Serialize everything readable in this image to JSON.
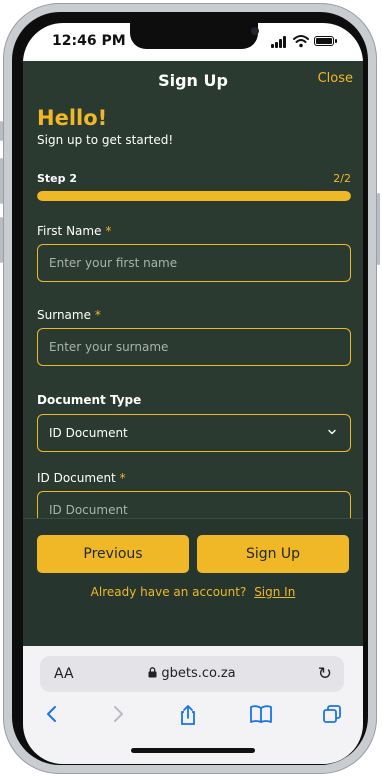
{
  "status_bar": {
    "time": "12:46 PM"
  },
  "header": {
    "title": "Sign Up",
    "close_label": "Close"
  },
  "intro": {
    "greeting": "Hello!",
    "subtitle": "Sign up to get started!"
  },
  "step": {
    "label": "Step 2",
    "count": "2/2",
    "progress": 1.0
  },
  "form": {
    "first_name": {
      "label": "First Name",
      "required_mark": "*",
      "placeholder": "Enter your first name",
      "value": ""
    },
    "surname": {
      "label": "Surname",
      "required_mark": "*",
      "placeholder": "Enter your surname",
      "value": ""
    },
    "document_type": {
      "label": "Document Type",
      "selected": "ID Document"
    },
    "id_document": {
      "label": "ID Document",
      "required_mark": "*",
      "placeholder": "ID Document",
      "value": ""
    }
  },
  "actions": {
    "previous_label": "Previous",
    "signup_label": "Sign Up",
    "already_text": "Already have an account?",
    "signin_label": "Sign In"
  },
  "browser": {
    "aa_label": "AA",
    "url": "gbets.co.za",
    "toolbar_icons": [
      "back-icon",
      "forward-icon",
      "share-icon",
      "bookmarks-icon",
      "tabs-icon"
    ]
  },
  "colors": {
    "background": "#2a3a31",
    "accent": "#f0b827",
    "text": "#ffffff"
  }
}
